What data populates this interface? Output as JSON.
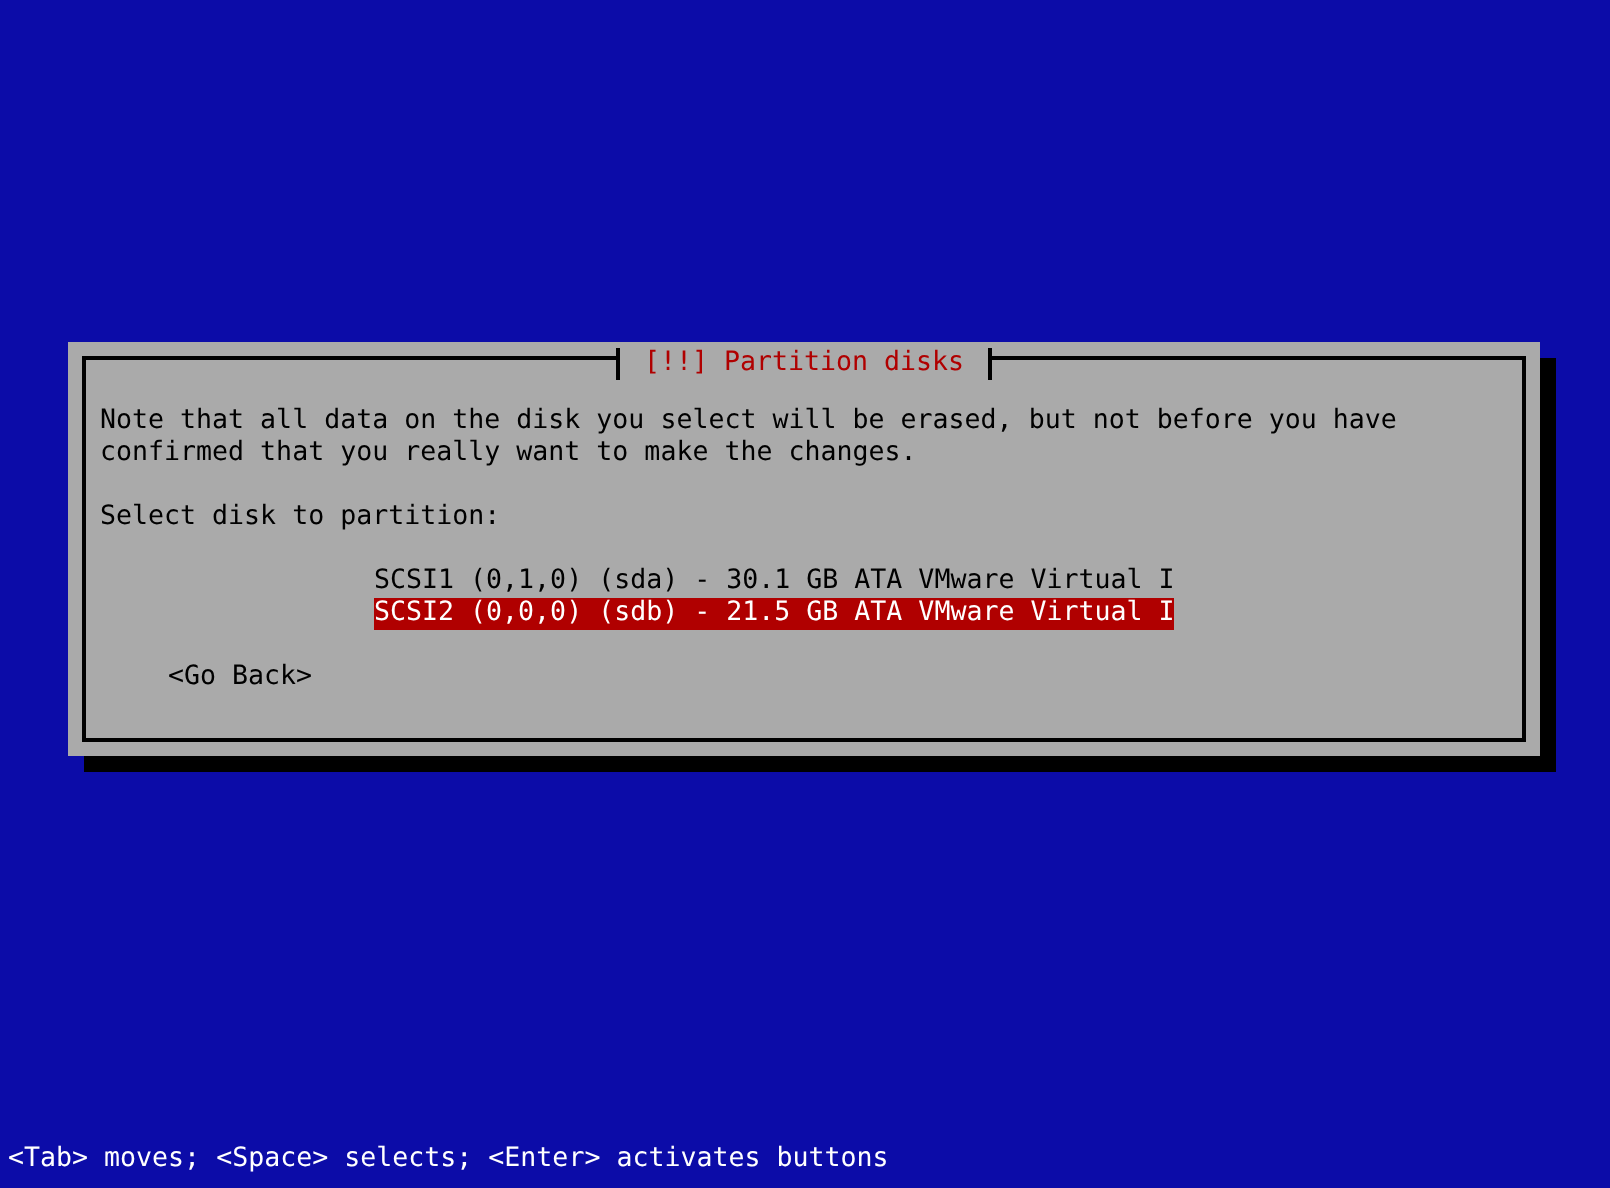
{
  "dialog": {
    "title": "[!!] Partition disks",
    "message": "Note that all data on the disk you select will be erased, but not before you have confirmed that you really want to make the changes.",
    "prompt": "Select disk to partition:",
    "disks": [
      {
        "label": "SCSI1 (0,1,0) (sda) - 30.1 GB ATA VMware Virtual I",
        "selected": false
      },
      {
        "label": "SCSI2 (0,0,0) (sdb) - 21.5 GB ATA VMware Virtual I",
        "selected": true
      }
    ],
    "back_button": "<Go Back>"
  },
  "status_bar": "<Tab> moves; <Space> selects; <Enter> activates buttons"
}
